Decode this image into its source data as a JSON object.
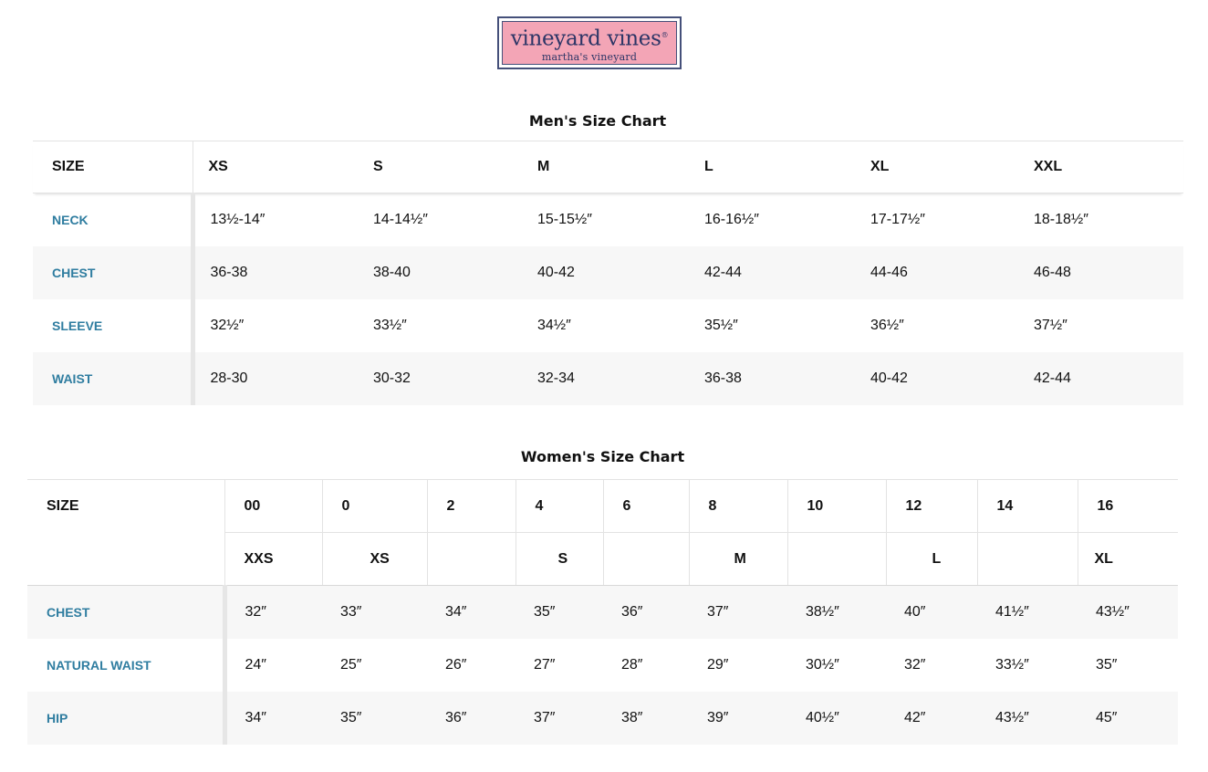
{
  "logo": {
    "brand": "vineyard vines",
    "registered": "®",
    "location": "martha's vineyard",
    "colors": {
      "background": "#f3a5b6",
      "text": "#2c3566",
      "border": "#45507a"
    }
  },
  "colors": {
    "row_label": "#2f7da0",
    "alt_row": "#f7f7f7"
  },
  "mens_chart": {
    "title": "Men's Size Chart",
    "size_label": "SIZE",
    "sizes": [
      "XS",
      "S",
      "M",
      "L",
      "XL",
      "XXL"
    ],
    "rows": [
      {
        "label": "NECK",
        "values": [
          "13½-14″",
          "14-14½″",
          "15-15½″",
          "16-16½″",
          "17-17½″",
          "18-18½″"
        ]
      },
      {
        "label": "CHEST",
        "values": [
          "36-38",
          "38-40",
          "40-42",
          "42-44",
          "44-46",
          "46-48"
        ]
      },
      {
        "label": "SLEEVE",
        "values": [
          "32½″",
          "33½″",
          "34½″",
          "35½″",
          "36½″",
          "37½″"
        ]
      },
      {
        "label": "WAIST",
        "values": [
          "28-30",
          "30-32",
          "32-34",
          "36-38",
          "40-42",
          "42-44"
        ]
      }
    ]
  },
  "womens_chart": {
    "title": "Women's Size Chart",
    "size_label": "SIZE",
    "numeric_sizes": [
      "00",
      "0",
      "2",
      "4",
      "6",
      "8",
      "10",
      "12",
      "14",
      "16"
    ],
    "letter_sizes": [
      "XXS",
      "XS",
      "",
      "S",
      "",
      "M",
      "",
      "L",
      "",
      "XL"
    ],
    "rows": [
      {
        "label": "CHEST",
        "values": [
          "32″",
          "33″",
          "34″",
          "35″",
          "36″",
          "37″",
          "38½″",
          "40″",
          "41½″",
          "43½″"
        ]
      },
      {
        "label": "NATURAL WAIST",
        "values": [
          "24″",
          "25″",
          "26″",
          "27″",
          "28″",
          "29″",
          "30½″",
          "32″",
          "33½″",
          "35″"
        ]
      },
      {
        "label": "HIP",
        "values": [
          "34″",
          "35″",
          "36″",
          "37″",
          "38″",
          "39″",
          "40½″",
          "42″",
          "43½″",
          "45″"
        ]
      }
    ]
  }
}
